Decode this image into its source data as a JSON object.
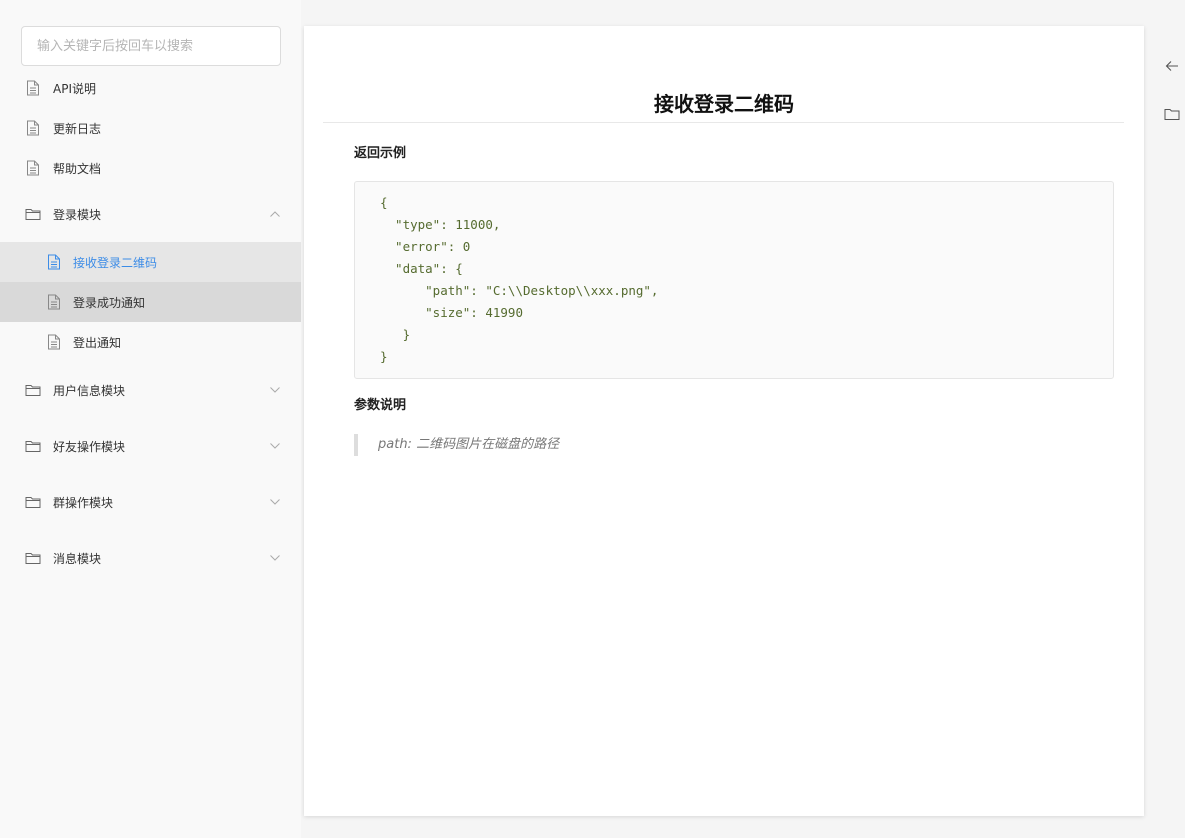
{
  "search": {
    "placeholder": "输入关键字后按回车以搜索"
  },
  "sidebar": {
    "items": [
      {
        "label": "API说明",
        "icon": "document-icon",
        "type": "doc"
      },
      {
        "label": "更新日志",
        "icon": "document-icon",
        "type": "doc"
      },
      {
        "label": "帮助文档",
        "icon": "document-icon",
        "type": "doc"
      },
      {
        "label": "登录模块",
        "icon": "folder-icon",
        "type": "folder",
        "expanded": true,
        "children": [
          {
            "label": "接收登录二维码",
            "active": true
          },
          {
            "label": "登录成功通知"
          },
          {
            "label": "登出通知"
          }
        ]
      },
      {
        "label": "用户信息模块",
        "icon": "folder-icon",
        "type": "folder",
        "expanded": false
      },
      {
        "label": "好友操作模块",
        "icon": "folder-icon",
        "type": "folder",
        "expanded": false
      },
      {
        "label": "群操作模块",
        "icon": "folder-icon",
        "type": "folder",
        "expanded": false
      },
      {
        "label": "消息模块",
        "icon": "folder-icon",
        "type": "folder",
        "expanded": false
      }
    ]
  },
  "main": {
    "title": "接收登录二维码",
    "return_example_heading": "返回示例",
    "code_lines": [
      "{",
      "  \"type\": 11000,",
      "  \"error\": 0",
      "  \"data\": {",
      "      \"path\": \"C:\\\\Desktop\\\\xxx.png\",",
      "      \"size\": 41990",
      "   }",
      "}"
    ],
    "params_heading": "参数说明",
    "params_note": "path: 二维码图片在磁盘的路径"
  },
  "right_toolbar": {
    "icons": [
      "arrow-left-icon",
      "folder-icon"
    ]
  },
  "colors": {
    "accent": "#3c8ce7",
    "active_bg": "#e6e6e6",
    "hover_bg": "#d9d9d9"
  }
}
